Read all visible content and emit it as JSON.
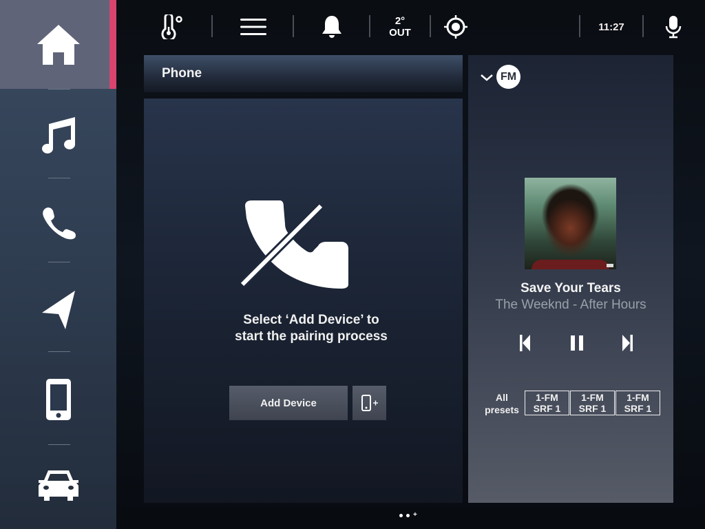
{
  "sidebar": {
    "active_accent": "#d9446f",
    "items": [
      {
        "name": "home",
        "icon": "home-icon",
        "active": true
      },
      {
        "name": "media",
        "icon": "music-note-icon",
        "active": false
      },
      {
        "name": "phone",
        "icon": "phone-icon",
        "active": false
      },
      {
        "name": "navigation",
        "icon": "navigation-arrow-icon",
        "active": false
      },
      {
        "name": "apps",
        "icon": "smartphone-icon",
        "active": false
      },
      {
        "name": "vehicle",
        "icon": "car-icon",
        "active": false
      }
    ]
  },
  "topbar": {
    "climate_icon": "thermometer-icon",
    "menu_icon": "hamburger-menu-icon",
    "notifications_icon": "bell-icon",
    "outside_temp": "2°",
    "outside_label": "OUT",
    "location_icon": "gps-target-icon",
    "time": "11:27",
    "voice_icon": "microphone-icon"
  },
  "phone": {
    "title": "Phone",
    "status_icon": "no-phone-icon",
    "message_line1": "Select ‘Add Device’ to",
    "message_line2": "start the pairing process",
    "add_device_label": "Add Device",
    "add_device_icon": "add-phone-icon"
  },
  "media": {
    "source": "FM",
    "source_menu_icon": "chevron-down-icon",
    "now_playing": {
      "title": "Save Your Tears",
      "artist_album": "The Weeknd - After Hours"
    },
    "controls": {
      "previous": "skip-previous-icon",
      "play_pause": "pause-icon",
      "next": "skip-next-icon"
    },
    "presets_label_line1": "All",
    "presets_label_line2": "presets",
    "presets": [
      {
        "line1": "1-FM",
        "line2": "SRF 1"
      },
      {
        "line1": "1-FM",
        "line2": "SRF 1"
      },
      {
        "line1": "1-FM",
        "line2": "SRF 1"
      }
    ]
  },
  "pager": {
    "pages": 2,
    "add_symbol": "+"
  }
}
